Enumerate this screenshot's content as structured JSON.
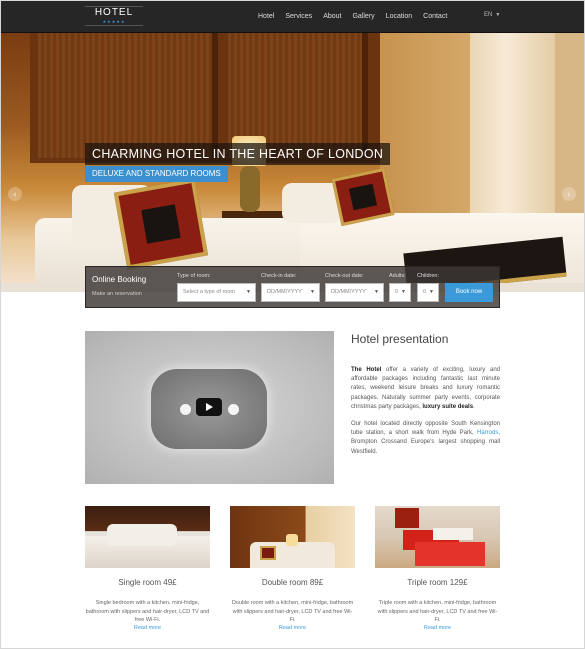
{
  "header": {
    "logo_text": "HOTEL",
    "logo_stars": "★★★★★",
    "nav": [
      "Hotel",
      "Services",
      "About",
      "Gallery",
      "Location",
      "Contact"
    ],
    "language": "EN"
  },
  "hero": {
    "title": "CHARMING HOTEL IN THE HEART OF LONDON",
    "subtitle": "DELUXE AND STANDARD ROOMS"
  },
  "booking": {
    "title": "Online Booking",
    "subtitle": "Make an reservation",
    "room_type_label": "Type of room:",
    "room_type_placeholder": "Select a type of room",
    "checkin_label": "Check-in date:",
    "checkin_placeholder": "DD/MM/YYYY",
    "checkout_label": "Check-out date:",
    "checkout_placeholder": "DD/MM/YYYY",
    "adults_label": "Adults:",
    "adults_value": "0",
    "children_label": "Children:",
    "children_value": "0",
    "button": "Book now"
  },
  "presentation": {
    "title": "Hotel presentation",
    "p1_strong": "The Hotel",
    "p1_text": " offer a variety of exciting, luxury and affordable packages including fantastic last minute rates, weekend leisure breaks and luxury romantic packages. Naturally summer party events, corporate christmas party packages, ",
    "p1_strong2": "luxury suite deals",
    "p1_end": ".",
    "p2_text": "Our hotel located directly opposite South Kensington tube station, a short walk from Hyde Park, ",
    "p2_link": "Harrods",
    "p2_end": ", Brompton Crossand Europe's largest shopping mall Westfield."
  },
  "rooms": [
    {
      "name": "Single room 49£",
      "desc": "Single bedroom with a kitchen, mini-fridge, bathroom with slippers and hair-dryer, LCD TV and free Wi-Fi.",
      "more": "Read more"
    },
    {
      "name": "Double room 89£",
      "desc": "Double room with a kitchen, mini-fridge, bathroom with slippers and hair-dryer, LCD TV and free Wi-Fi.",
      "more": "Read more"
    },
    {
      "name": "Triple room 129£",
      "desc": "Triple room with a kitchen, mini-fridge, bathroom with slippers and hair-dryer, LCD TV and free Wi-Fi.",
      "more": "Read more"
    }
  ],
  "colors": {
    "accent": "#3a9ad9",
    "navbar": "#262626"
  },
  "icons": [
    "chevron-left-icon",
    "chevron-right-icon",
    "caret-down-icon",
    "play-icon"
  ]
}
